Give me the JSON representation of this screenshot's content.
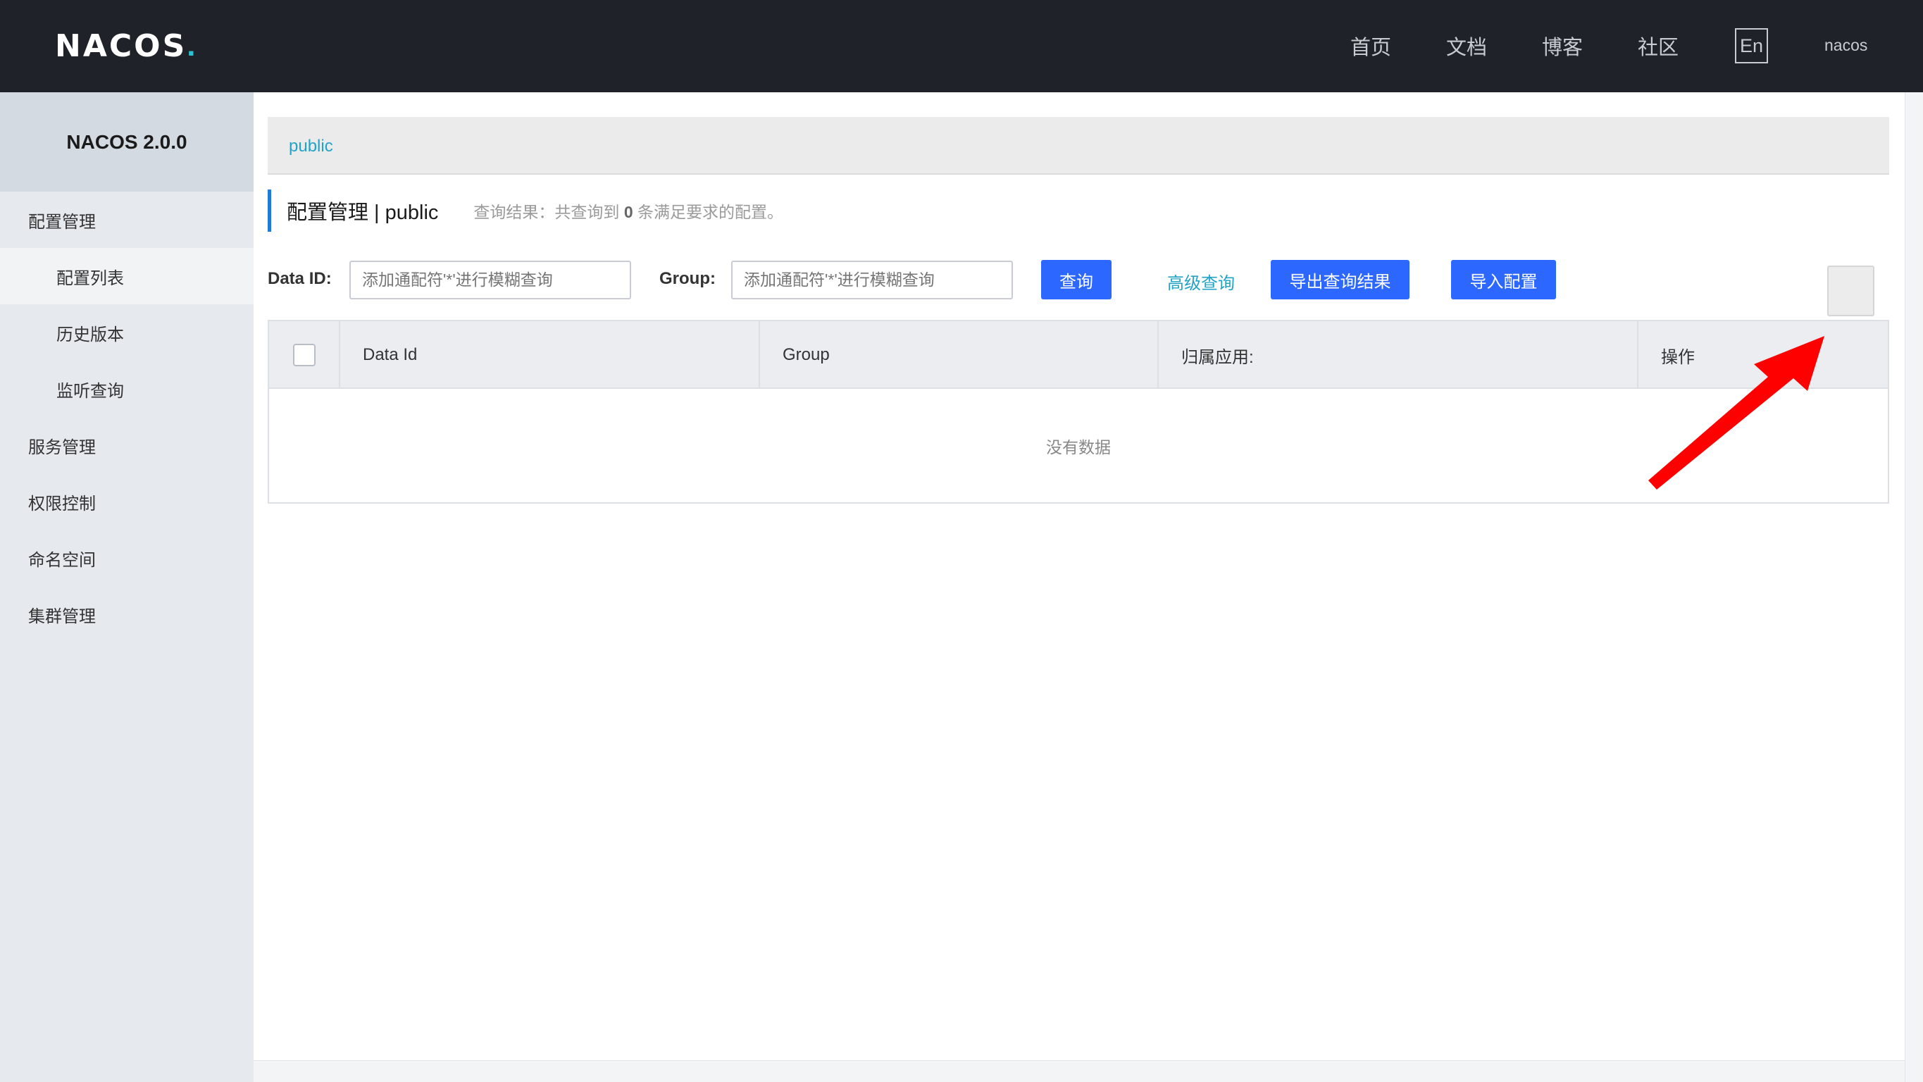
{
  "header": {
    "logo_text": "NACOS",
    "logo_dot": ".",
    "nav": [
      "首页",
      "文档",
      "博客",
      "社区"
    ],
    "lang": "En",
    "user": "nacos"
  },
  "sidebar": {
    "title": "NACOS 2.0.0",
    "items": [
      {
        "label": "配置管理",
        "level": 1
      },
      {
        "label": "配置列表",
        "level": 2,
        "active": true
      },
      {
        "label": "历史版本",
        "level": 2
      },
      {
        "label": "监听查询",
        "level": 2
      },
      {
        "label": "服务管理",
        "level": 1
      },
      {
        "label": "权限控制",
        "level": 1
      },
      {
        "label": "命名空间",
        "level": 1
      },
      {
        "label": "集群管理",
        "level": 1
      }
    ]
  },
  "namespace": {
    "current": "public"
  },
  "page": {
    "title": "配置管理 | public",
    "hint_prefix": "查询结果：共查询到",
    "hint_count": "0",
    "hint_suffix": "条满足要求的配置。"
  },
  "filters": {
    "data_id_label": "Data ID:",
    "data_id_placeholder": "添加通配符'*'进行模糊查询",
    "group_label": "Group:",
    "group_placeholder": "添加通配符'*'进行模糊查询",
    "query_button": "查询",
    "advanced_query": "高级查询",
    "export_button": "导出查询结果",
    "import_button": "导入配置"
  },
  "table": {
    "columns": [
      "Data Id",
      "Group",
      "归属应用:",
      "操作"
    ],
    "empty_text": "没有数据"
  },
  "colors": {
    "header_bg": "#1f2329",
    "primary": "#2c68ff",
    "link": "#23a3c8",
    "arrow": "#ff0000"
  }
}
